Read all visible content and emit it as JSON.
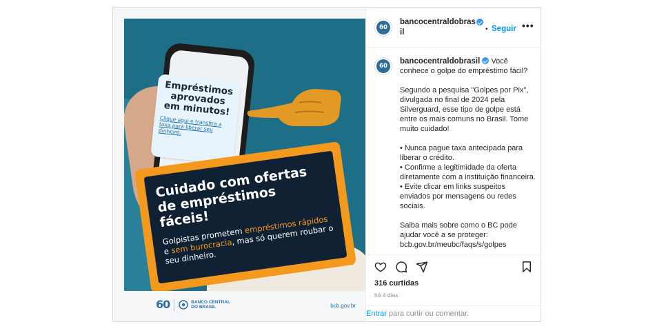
{
  "media": {
    "bubble_title": "Empréstimos aprovados em minutos!",
    "bubble_link": "Clique aqui e transfira a taxa para liberar seu dinheiro.",
    "notice_title": "Cuidado com ofertas de empréstimos fáceis!",
    "notice_text_1": "Golpistas prometem ",
    "notice_hl_1": "empréstimos rápidos",
    "notice_text_2": " e ",
    "notice_hl_2": "sem burocracia",
    "notice_text_3": ", mas só querem roubar o seu dinheiro.",
    "footer_logo_60": "60",
    "footer_logo_name_1": "BANCO CENTRAL",
    "footer_logo_name_2": "DO BRASIL",
    "footer_url": "bcb.gov.br"
  },
  "header": {
    "username": "bancocentraldobrasil",
    "follow_label": "Seguir",
    "dot": "•",
    "more_label": "•••"
  },
  "avatar_text": "60",
  "caption": {
    "username": "bancocentraldobrasil",
    "intro": "Você conhece o golpe do empréstimo fácil?",
    "paragraph_1": "Segundo a pesquisa \"Golpes por Pix\", divulgada no final de 2024 pela Silverguard, esse tipo de golpe está entre os mais comuns no Brasil. Tome muito cuidado!",
    "bullets": "• Nunca pague taxa antecipada para liberar o crédito.\n• Confirme a legitimidade da oferta diretamente com a instituição financeira.\n• Evite clicar em links suspeitos enviados por mensagens ou redes sociais.",
    "paragraph_3": "Saiba mais sobre como o BC pode ajudar você a se proteger:",
    "link_partial": "bcb.gov.br/meubc/faqs/s/golpes"
  },
  "likes": "316 curtidas",
  "time": "há 4 dias",
  "comment": {
    "login_label": "Entrar",
    "rest_label": " para curtir ou comentar."
  },
  "colors": {
    "accent": "#0095f6",
    "verified": "#3897f0",
    "brand_blue": "#2d6fa5",
    "warning_orange": "#f39a1e",
    "panel_navy": "#0f2133"
  }
}
